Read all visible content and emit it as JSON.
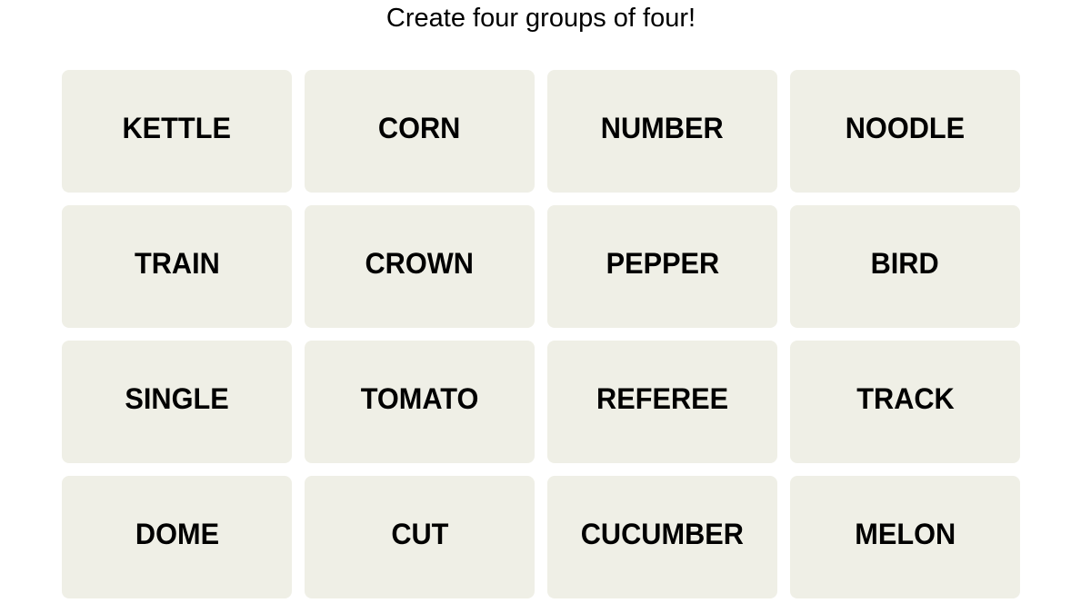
{
  "header": {
    "prompt": "Create four groups of four!"
  },
  "colors": {
    "tile_background": "#efefe6",
    "tile_text": "#000000",
    "page_background": "#ffffff"
  },
  "board": {
    "tiles": [
      {
        "label": "KETTLE"
      },
      {
        "label": "CORN"
      },
      {
        "label": "NUMBER"
      },
      {
        "label": "NOODLE"
      },
      {
        "label": "TRAIN"
      },
      {
        "label": "CROWN"
      },
      {
        "label": "PEPPER"
      },
      {
        "label": "BIRD"
      },
      {
        "label": "SINGLE"
      },
      {
        "label": "TOMATO"
      },
      {
        "label": "REFEREE"
      },
      {
        "label": "TRACK"
      },
      {
        "label": "DOME"
      },
      {
        "label": "CUT"
      },
      {
        "label": "CUCUMBER"
      },
      {
        "label": "MELON"
      }
    ]
  }
}
